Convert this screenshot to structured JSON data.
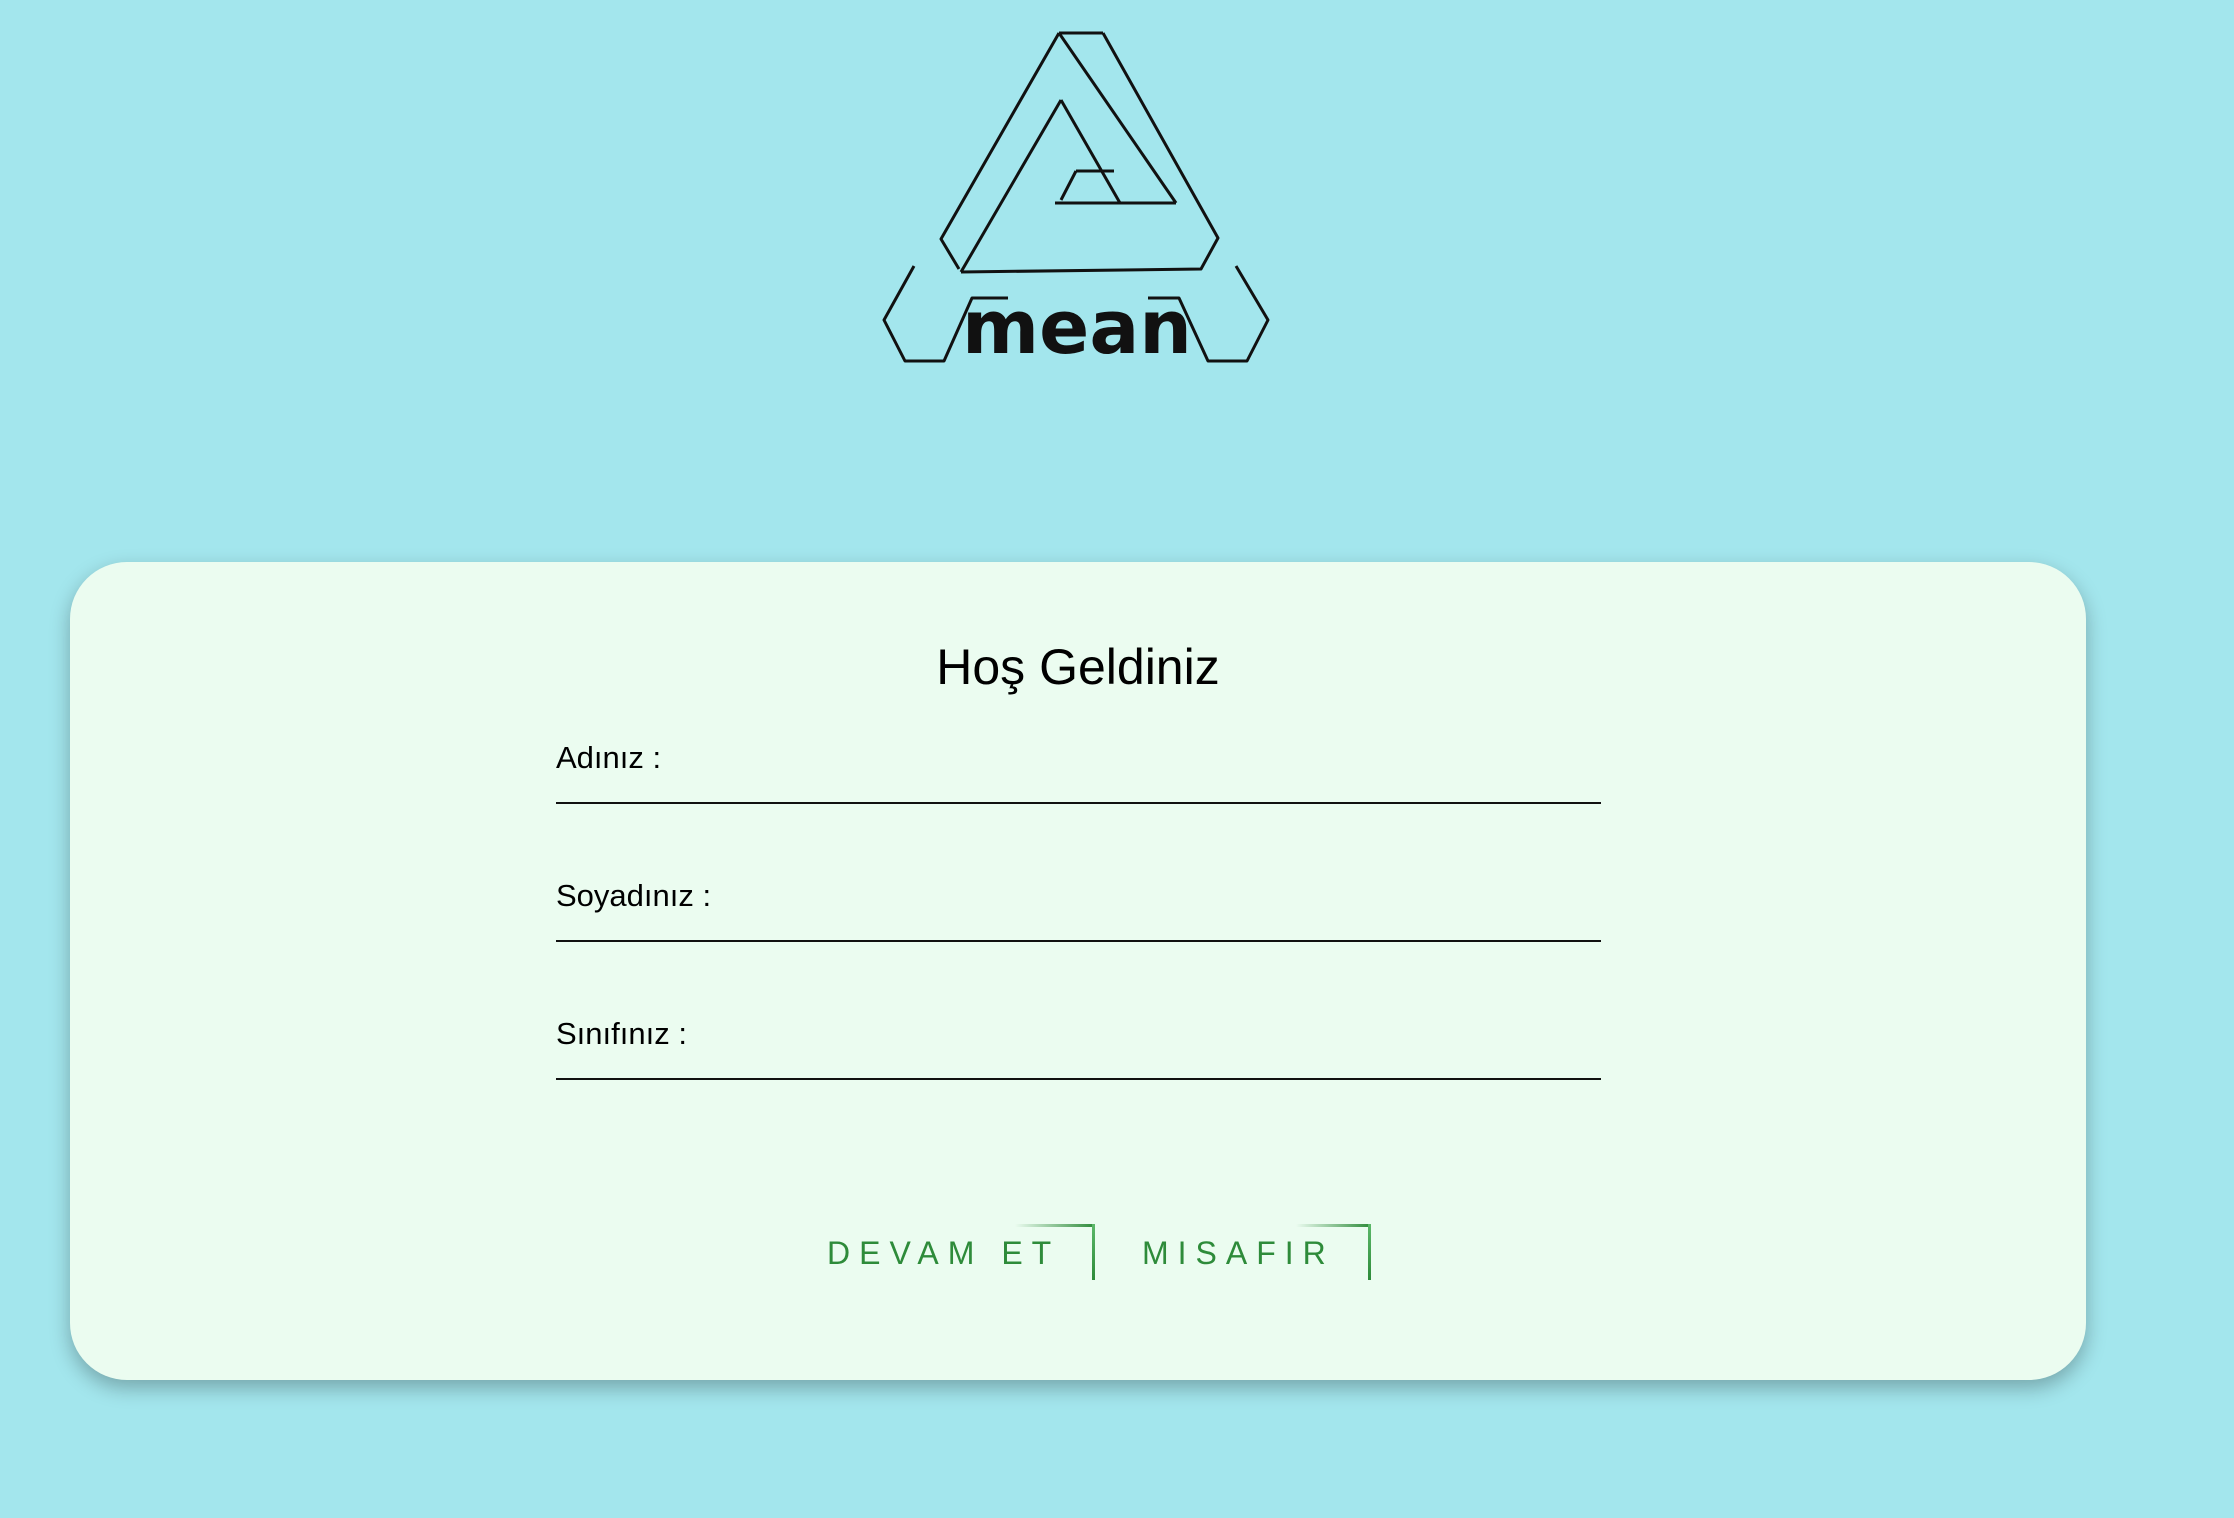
{
  "logo": {
    "brand_text": "mean"
  },
  "form": {
    "title": "Hoş Geldiniz",
    "fields": [
      {
        "label": "Adınız :",
        "value": ""
      },
      {
        "label": "Soyadınız :",
        "value": ""
      },
      {
        "label": "Sınıfınız :",
        "value": ""
      }
    ],
    "buttons": {
      "continue_label": "DEVAM ET",
      "guest_label": "MISAFIR"
    }
  },
  "colors": {
    "background": "#a3e6ed",
    "card": "#ebfcf0",
    "button_text": "#2e8b3a"
  }
}
